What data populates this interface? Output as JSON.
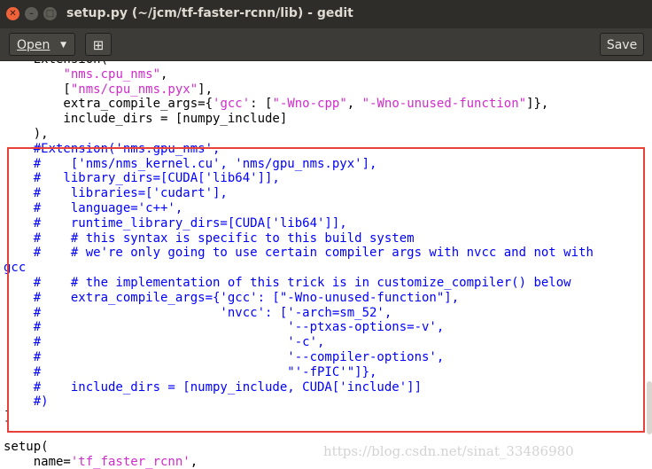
{
  "window": {
    "title": "setup.py (~/jcm/tf-faster-rcnn/lib) - gedit",
    "close_glyph": "✕",
    "min_glyph": "–",
    "max_glyph": "□"
  },
  "toolbar": {
    "open_label": "Open",
    "open_chevron": "▼",
    "new_tab_glyph": "⊞",
    "save_label": "Save"
  },
  "editor": {
    "lines": [
      [
        {
          "t": "    Extension("
        }
      ],
      [
        {
          "t": "        "
        },
        {
          "t": "\"nms.cpu_nms\"",
          "k": "s"
        },
        {
          "t": ","
        }
      ],
      [
        {
          "t": "        ["
        },
        {
          "t": "\"nms/cpu_nms.pyx\"",
          "k": "s"
        },
        {
          "t": "],"
        }
      ],
      [
        {
          "t": "        extra_compile_args={"
        },
        {
          "t": "'gcc'",
          "k": "s"
        },
        {
          "t": ": ["
        },
        {
          "t": "\"-Wno-cpp\"",
          "k": "s"
        },
        {
          "t": ", "
        },
        {
          "t": "\"-Wno-unused-function\"",
          "k": "s"
        },
        {
          "t": "]},"
        }
      ],
      [
        {
          "t": "        include_dirs = [numpy_include]"
        }
      ],
      [
        {
          "t": "    ),"
        }
      ],
      [
        {
          "t": "    #Extension('nms.gpu_nms',",
          "k": "c"
        }
      ],
      [
        {
          "t": "    #    ['nms/nms_kernel.cu', 'nms/gpu_nms.pyx'],",
          "k": "c"
        }
      ],
      [
        {
          "t": "    #   library_dirs=[CUDA['lib64']],",
          "k": "c"
        }
      ],
      [
        {
          "t": "    #    libraries=['cudart'],",
          "k": "c"
        }
      ],
      [
        {
          "t": "    #    language='c++',",
          "k": "c"
        }
      ],
      [
        {
          "t": "    #    runtime_library_dirs=[CUDA['lib64']],",
          "k": "c"
        }
      ],
      [
        {
          "t": "    #    # this syntax is specific to this build system",
          "k": "c"
        }
      ],
      [
        {
          "t": "    #    # we're only going to use certain compiler args with nvcc and not with",
          "k": "c"
        }
      ],
      [
        {
          "t": "gcc",
          "k": "c"
        }
      ],
      [
        {
          "t": "    #    # the implementation of this trick is in customize_compiler() below",
          "k": "c"
        }
      ],
      [
        {
          "t": "    #    extra_compile_args={'gcc': [\"-Wno-unused-function\"],",
          "k": "c"
        }
      ],
      [
        {
          "t": "    #                        'nvcc': ['-arch=sm_52',",
          "k": "c"
        }
      ],
      [
        {
          "t": "    #                                 '--ptxas-options=-v',",
          "k": "c"
        }
      ],
      [
        {
          "t": "    #                                 '-c',",
          "k": "c"
        }
      ],
      [
        {
          "t": "    #                                 '--compiler-options',",
          "k": "c"
        }
      ],
      [
        {
          "t": "    #                                 \"'-fPIC'\"]},",
          "k": "c"
        }
      ],
      [
        {
          "t": "    #    include_dirs = [numpy_include, CUDA['include']]",
          "k": "c"
        }
      ],
      [
        {
          "t": "    #)",
          "k": "c"
        }
      ],
      [
        {
          "t": "]"
        }
      ],
      [
        {
          "t": ""
        }
      ],
      [
        {
          "t": "setup("
        }
      ],
      [
        {
          "t": "    name="
        },
        {
          "t": "'tf_faster_rcnn'",
          "k": "s"
        },
        {
          "t": ","
        }
      ]
    ]
  },
  "watermark": "https://blog.csdn.net/sinat_33486980"
}
